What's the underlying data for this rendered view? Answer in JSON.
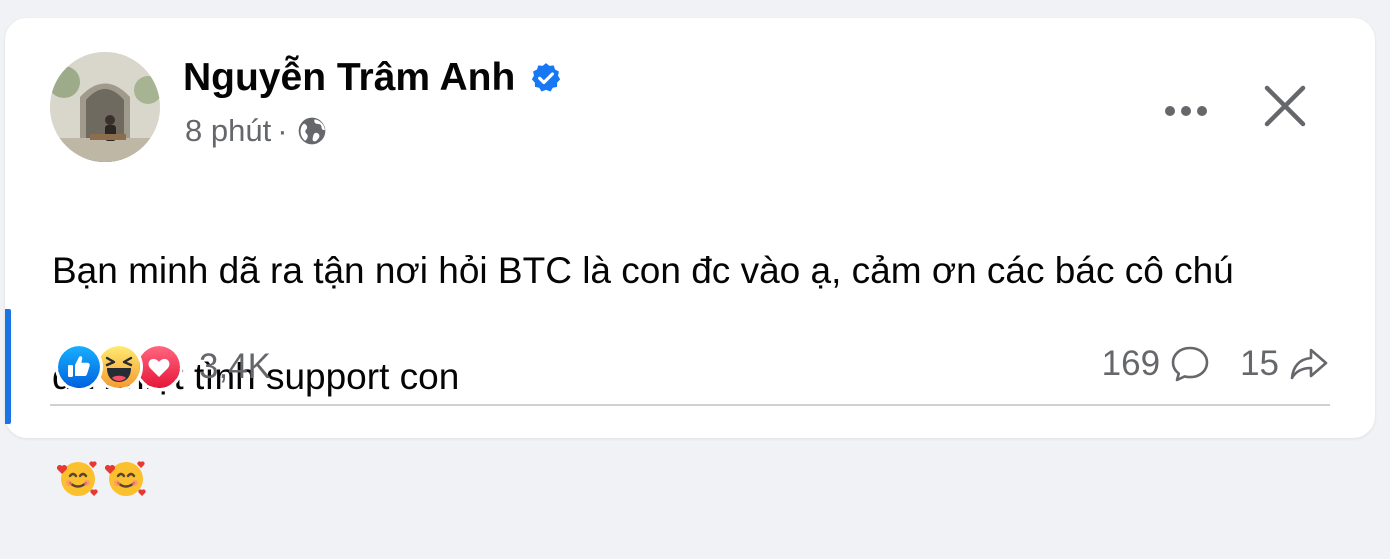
{
  "post": {
    "author_name": "Nguyễn Trâm Anh",
    "verified": true,
    "time": "8 phút",
    "separator": "·",
    "audience_icon": "globe-icon",
    "text_line1": "Bạn minh dã ra tận nơi hỏi BTC là con đc vào ạ, cảm ơn các bác cô chú",
    "text_line2": "đã nhiệt tình support con",
    "text_emojis": [
      "smiling-face-with-hearts",
      "smiling-face-with-hearts"
    ],
    "more_icon": "more-horizontal-icon",
    "close_icon": "close-icon"
  },
  "reactions": {
    "types": [
      "like",
      "haha",
      "love"
    ],
    "count": "3,4K"
  },
  "stats": {
    "comments": "169",
    "comment_icon": "comment-icon",
    "shares": "15",
    "share_icon": "share-icon"
  },
  "colors": {
    "accent": "#1b74e4",
    "verified": "#1877f2",
    "love": "#f33e58",
    "haha": "#f7b125",
    "secondary_text": "#65676b"
  }
}
